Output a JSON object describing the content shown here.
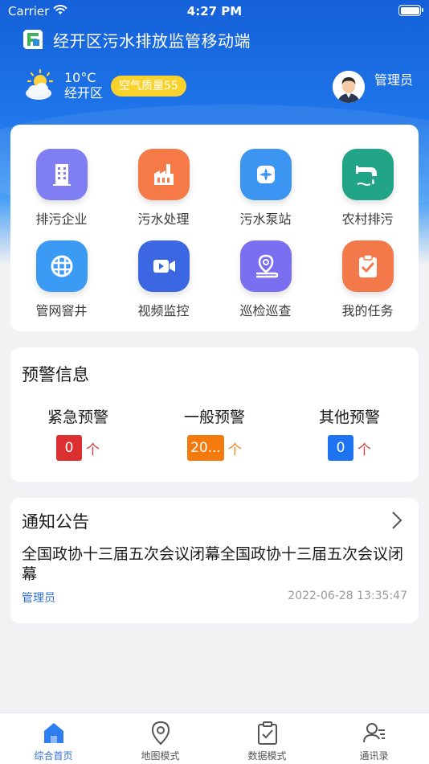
{
  "status_bar": {
    "carrier": "Carrier",
    "time": "4:27 PM"
  },
  "header": {
    "title": "经开区污水排放监管移动端",
    "logo_icon": "app-logo-icon"
  },
  "weather": {
    "temperature": "10°C",
    "location": "经开区",
    "aqi": "空气质量55",
    "icon": "partly-cloudy-icon"
  },
  "user": {
    "name": "管理员",
    "avatar_icon": "avatar-icon"
  },
  "grid": {
    "items": [
      {
        "label": "排污企业",
        "icon": "building-icon",
        "color": "#7f7ef2"
      },
      {
        "label": "污水处理",
        "icon": "factory-icon",
        "color": "#f57a47"
      },
      {
        "label": "污水泵站",
        "icon": "pump-icon",
        "color": "#3d95f2"
      },
      {
        "label": "农村排污",
        "icon": "pipe-outflow-icon",
        "color": "#21a586"
      },
      {
        "label": "管网窨井",
        "icon": "manhole-grid-icon",
        "color": "#3a9af4"
      },
      {
        "label": "视频监控",
        "icon": "video-camera-icon",
        "color": "#3c67e3"
      },
      {
        "label": "巡检巡查",
        "icon": "location-pin-icon",
        "color": "#7a6ef1"
      },
      {
        "label": "我的任务",
        "icon": "clipboard-check-icon",
        "color": "#f3794a"
      }
    ]
  },
  "alerts": {
    "title": "预警信息",
    "items": [
      {
        "name": "紧急预警",
        "count": "0",
        "unit": "个",
        "color": "#dc3030",
        "unit_color": "#d43a3a"
      },
      {
        "name": "一般预警",
        "count": "20...",
        "unit": "个",
        "color": "#f47a0e",
        "unit_color": "#f08218"
      },
      {
        "name": "其他预警",
        "count": "0",
        "unit": "个",
        "color": "#1d73f0",
        "unit_color": "#d43a3a"
      }
    ]
  },
  "notice": {
    "title": "通知公告",
    "text": "全国政协十三届五次会议闭幕全国政协十三届五次会议闭幕",
    "author": "管理员",
    "time": "2022-06-28 13:35:47"
  },
  "tabbar": {
    "items": [
      {
        "label": "综合首页",
        "icon": "home-icon",
        "active": true
      },
      {
        "label": "地图模式",
        "icon": "map-pin-icon",
        "active": false
      },
      {
        "label": "数据模式",
        "icon": "clipboard-check-icon",
        "active": false
      },
      {
        "label": "通讯录",
        "icon": "contacts-icon",
        "active": false
      }
    ]
  },
  "colors": {
    "accent": "#2f6fd8",
    "hero_blue": "#1460d8",
    "aqi_badge": "#f9d22e"
  }
}
